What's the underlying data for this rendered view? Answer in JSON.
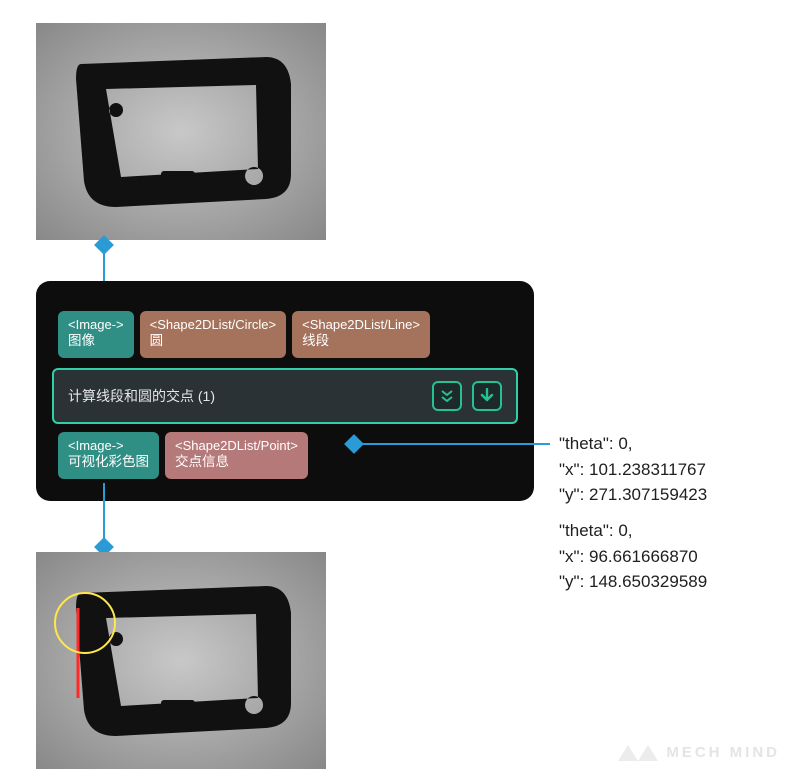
{
  "node": {
    "title": "计算线段和圆的交点 (1)",
    "inputs": [
      {
        "type": "<Image->",
        "label": "图像"
      },
      {
        "type": "<Shape2DList/Circle>",
        "label": "圆"
      },
      {
        "type": "<Shape2DList/Line>",
        "label": "线段"
      }
    ],
    "outputs": [
      {
        "type": "<Image->",
        "label": "可视化彩色图"
      },
      {
        "type": "<Shape2DList/Point>",
        "label": "交点信息"
      }
    ]
  },
  "results": [
    {
      "theta": 0,
      "x": "101.238311767",
      "y": "271.307159423"
    },
    {
      "theta": 0,
      "x": "96.661666870",
      "y": "148.650329589"
    }
  ],
  "result_lines": {
    "p0_theta": "\"theta\": 0,",
    "p0_x": "\"x\": 101.238311767",
    "p0_y": "\"y\": 271.307159423",
    "p1_theta": "\"theta\": 0,",
    "p1_x": "\"x\": 96.661666870",
    "p1_y": "\"y\": 148.650329589"
  },
  "watermark": "MECH MIND"
}
